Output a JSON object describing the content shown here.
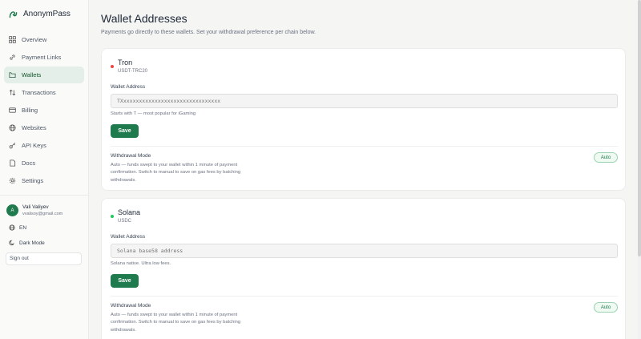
{
  "app": {
    "name": "AnonymPass"
  },
  "sidebar": {
    "items": [
      {
        "label": "Overview",
        "icon": "grid-icon",
        "active": false
      },
      {
        "label": "Payment Links",
        "icon": "link-icon",
        "active": false
      },
      {
        "label": "Wallets",
        "icon": "wallet-icon",
        "active": true
      },
      {
        "label": "Transactions",
        "icon": "arrows-icon",
        "active": false
      },
      {
        "label": "Billing",
        "icon": "card-icon",
        "active": false
      },
      {
        "label": "Websites",
        "icon": "globe-icon",
        "active": false
      },
      {
        "label": "API Keys",
        "icon": "key-icon",
        "active": false
      },
      {
        "label": "Docs",
        "icon": "doc-icon",
        "active": false
      },
      {
        "label": "Settings",
        "icon": "gear-icon",
        "active": false
      }
    ],
    "user": {
      "initials": "A",
      "name": "Vali Valiyev",
      "email": "vvalisoy@gmail.com"
    },
    "language": "EN",
    "dark_mode_label": "Dark Mode",
    "sign_out_label": "Sign out"
  },
  "page": {
    "title": "Wallet Addresses",
    "subtitle": "Payments go directly to these wallets. Set your withdrawal preference per chain below."
  },
  "wallets": [
    {
      "chain": "Tron",
      "token": "USDT-TRC20",
      "dot_color": "#ef4444",
      "address_label": "Wallet Address",
      "placeholder": "TXxxxxxxxxxxxxxxxxxxxxxxxxxxxxxxx",
      "hint": "Starts with T — most popular for iGaming",
      "save_label": "Save",
      "withdrawal_title": "Withdrawal Mode",
      "withdrawal_desc": "Auto — funds swept to your wallet within 1 minute of payment confirmation. Switch to manual to save on gas fees by batching withdrawals.",
      "mode": "Auto"
    },
    {
      "chain": "Solana",
      "token": "USDC",
      "dot_color": "#22c55e",
      "address_label": "Wallet Address",
      "placeholder": "Solana base58 address",
      "hint": "Solana native. Ultra low fees.",
      "save_label": "Save",
      "withdrawal_title": "Withdrawal Mode",
      "withdrawal_desc": "Auto — funds swept to your wallet within 1 minute of payment confirmation. Switch to manual to save on gas fees by batching withdrawals.",
      "mode": "Auto"
    }
  ],
  "colors": {
    "accent": "#1f7a4d",
    "active_bg": "#e3efe8"
  }
}
